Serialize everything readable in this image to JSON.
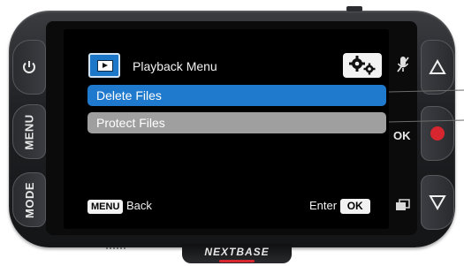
{
  "device": {
    "brand": "NEXTBASE",
    "left_buttons": {
      "power_icon": "power-icon",
      "menu_label": "MENU",
      "mode_label": "MODE"
    },
    "right_buttons": {
      "mic_mute_icon": "mic-mute-icon",
      "up_icon": "triangle-up-icon",
      "ok_label": "OK",
      "record_icon": "record-icon",
      "down_icon": "triangle-down-icon",
      "protect_icon": "protect-file-icon"
    }
  },
  "screen": {
    "header": {
      "icon": "playback-icon",
      "title": "Playback Menu",
      "settings_icon": "gear-icon"
    },
    "menu_items": [
      {
        "label": "Delete Files",
        "selected": true
      },
      {
        "label": "Protect Files",
        "selected": false
      }
    ],
    "footer": {
      "back_key": "MENU",
      "back_label": "Back",
      "enter_label": "Enter",
      "enter_key": "OK"
    }
  },
  "colors": {
    "selected": "#1f79cc",
    "unselected": "#9f9f9f",
    "record": "#d7262f"
  }
}
